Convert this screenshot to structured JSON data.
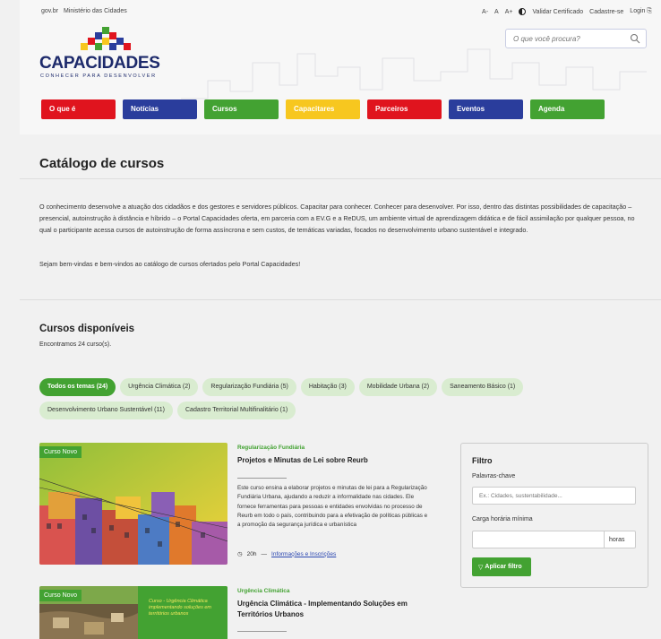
{
  "header": {
    "gov_links": [
      "gov.br",
      "Ministério das Cidades"
    ],
    "font_controls": [
      "A-",
      "A",
      "A+"
    ],
    "util_links": [
      "Validar Certificado",
      "Cadastre-se",
      "Login"
    ],
    "search_placeholder": "O que você procura?"
  },
  "logo": {
    "brand": "CAPACIDADES",
    "tagline": "CONHECER PARA DESENVOLVER"
  },
  "nav": [
    {
      "label": "O que é",
      "color": "#e0141e"
    },
    {
      "label": "Notícias",
      "color": "#2a3d9c"
    },
    {
      "label": "Cursos",
      "color": "#43a232"
    },
    {
      "label": "Capacitares",
      "color": "#f7c71f"
    },
    {
      "label": "Parceiros",
      "color": "#e0141e"
    },
    {
      "label": "Eventos",
      "color": "#2a3d9c"
    },
    {
      "label": "Agenda",
      "color": "#43a232"
    }
  ],
  "page": {
    "title": "Catálogo de cursos",
    "intro_1": "O conhecimento desenvolve a atuação dos cidadãos e dos gestores e servidores públicos. Capacitar para conhecer. Conhecer para desenvolver. Por isso, dentro das distintas possibilidades de capacitação – presencial, autoinstrução à distância e híbrido – o Portal Capacidades oferta, em parceria com a EV.G e a ReDUS, um ambiente virtual de aprendizagem didática e de fácil assimilação por qualquer pessoa, no qual o participante acessa cursos de autoinstrução de forma assíncrona e sem custos, de temáticas variadas, focados no desenvolvimento urbano sustentável e integrado.",
    "intro_2": "Sejam bem-vindas e bem-vindos ao catálogo de cursos ofertados pelo Portal Capacidades!"
  },
  "courses": {
    "title": "Cursos disponíveis",
    "count_text": "Encontramos 24 curso(s).",
    "chips_row1": [
      "Todos os temas (24)",
      "Urgência Climática (2)",
      "Regularização Fundiária (5)",
      "Habitação (3)",
      "Mobilidade Urbana (2)",
      "Saneamento Básico (1)"
    ],
    "chips_row2": [
      "Desenvolvimento Urbano Sustentável (11)",
      "Cadastro Territorial Multifinalitário (1)"
    ],
    "items": [
      {
        "badge": "Curso Novo",
        "theme": "Regularização Fundiária",
        "name": "Projetos e Minutas de Lei sobre Reurb",
        "description": "Este curso ensina a elaborar projetos e minutas de lei para a Regularização Fundiária Urbana, ajudando a reduzir a informalidade nas cidades. Ele fornece ferramentas para pessoas e entidades envolvidas no processo de Reurb em todo o país, contribuindo para a efetivação de políticas públicas e a promoção da segurança jurídica e urbanística",
        "hours": "20h",
        "link": "Informações e Inscrições"
      },
      {
        "badge": "Curso Novo",
        "theme": "Urgência Climática",
        "name": "Urgência Climática - Implementando Soluções em Territórios Urbanos",
        "image_text": "Curso - Urgência Climática implementando soluções em territórios urbanos"
      }
    ]
  },
  "filter": {
    "title": "Filtro",
    "keywords_label": "Palavras-chave",
    "keywords_placeholder": "Ex.: Cidades, sustentabilidade...",
    "hours_label": "Carga horária mínima",
    "hours_suffix": "horas",
    "apply_label": "Aplicar filtro"
  }
}
